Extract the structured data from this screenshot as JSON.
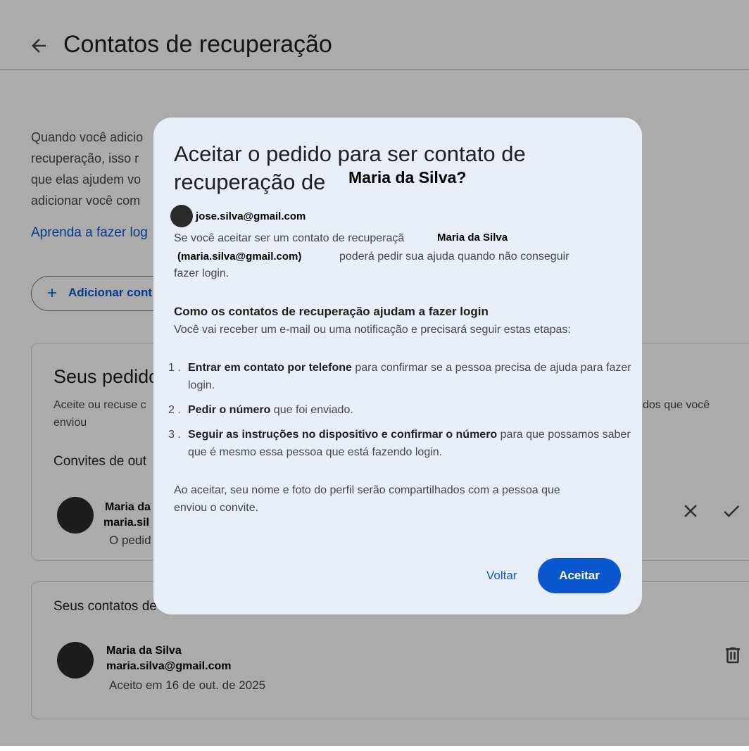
{
  "page": {
    "title": "Contatos de recuperação",
    "intro_lines": [
      "Quando você adicio",
      "recuperação, isso r",
      "que elas ajudem vo",
      "adicionar você com"
    ],
    "learn_link": "Aprenda a fazer log",
    "add_button": "Adicionar cont"
  },
  "requests_card": {
    "title": "Seus pedido",
    "subtitle_left": "Aceite ou recuse c",
    "subtitle_left_2": "enviou",
    "subtitle_right": "dos que você",
    "invites_title": "Convites de out",
    "invite": {
      "name": "Maria da",
      "email": "maria.sil",
      "note": "O pedid"
    }
  },
  "contacts_card": {
    "title": "Seus contatos de",
    "contact": {
      "name": "Maria da Silva",
      "email": "maria.silva@gmail.com",
      "note": "Aceito em 16 de out. de 2025"
    }
  },
  "dialog": {
    "title_line1": "Aceitar o pedido para ser contato de",
    "title_line2": "recuperação de",
    "title_name": "Maria da Silva?",
    "account_email": "jose.silva@gmail.com",
    "para1_a": "Se você aceitar ser um contato de recuperaçã",
    "para1_name": "Maria da Silva",
    "para1_email": "(maria.silva@gmail.com)",
    "para1_b": "poderá pedir sua ajuda quando não conseguir",
    "para1_c": "fazer login.",
    "section_title": "Como os contatos de recuperação ajudam a fazer login",
    "section_sub": "Você vai receber um e-mail ou uma notificação e precisará seguir estas etapas:",
    "steps": [
      {
        "num": "1 .",
        "bold": "Entrar em contato por telefone",
        "rest": " para confirmar se a pessoa precisa de ajuda para fazer login."
      },
      {
        "num": "2 .",
        "bold": "Pedir o número",
        "rest": " que foi enviado."
      },
      {
        "num": "3 .",
        "bold": "Seguir as instruções no dispositivo e confirmar o número",
        "rest": " para que possamos saber que é mesmo essa pessoa que está fazendo login."
      }
    ],
    "footer_line1": "Ao aceitar, seu nome e foto do perfil serão compartilhados com a pessoa que",
    "footer_line2": "enviou o convite.",
    "back_label": "Voltar",
    "accept_label": "Aceitar"
  },
  "colors": {
    "accent": "#0b57d0",
    "dialog_bg": "#e9eef6",
    "scrim": "rgba(0,0,0,0.33)"
  },
  "icons": [
    "arrow-back-icon",
    "plus-icon",
    "close-icon",
    "check-icon",
    "trash-icon"
  ]
}
